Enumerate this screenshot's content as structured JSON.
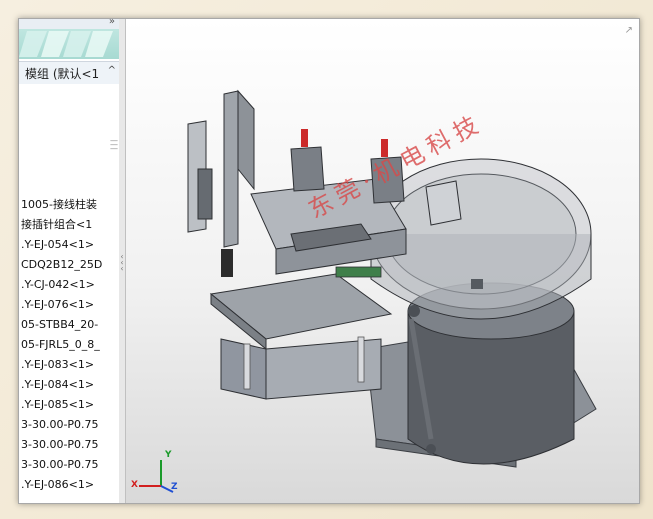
{
  "tree": {
    "config_label": "模组 (默认<1",
    "items": [
      "1005-接线柱装",
      "接插针组合<1",
      ".Y-EJ-054<1>",
      "CDQ2B12_25D",
      ".Y-CJ-042<1>",
      ".Y-EJ-076<1>",
      "05-STBB4_20-",
      "05-FJRL5_0_8_",
      ".Y-EJ-083<1>",
      ".Y-EJ-084<1>",
      ".Y-EJ-085<1>",
      "3-30.00-P0.75",
      "3-30.00-P0.75",
      "3-30.00-P0.75",
      ".Y-EJ-086<1>"
    ]
  },
  "graphics": {
    "watermark": "东莞·机电科技",
    "triad": {
      "x": "X",
      "y": "Y",
      "z": "Z"
    }
  },
  "colors": {
    "accent": "#2a6ed1",
    "clamp_red": "#cc2a2a",
    "model_gray": "#9aa0a6"
  }
}
